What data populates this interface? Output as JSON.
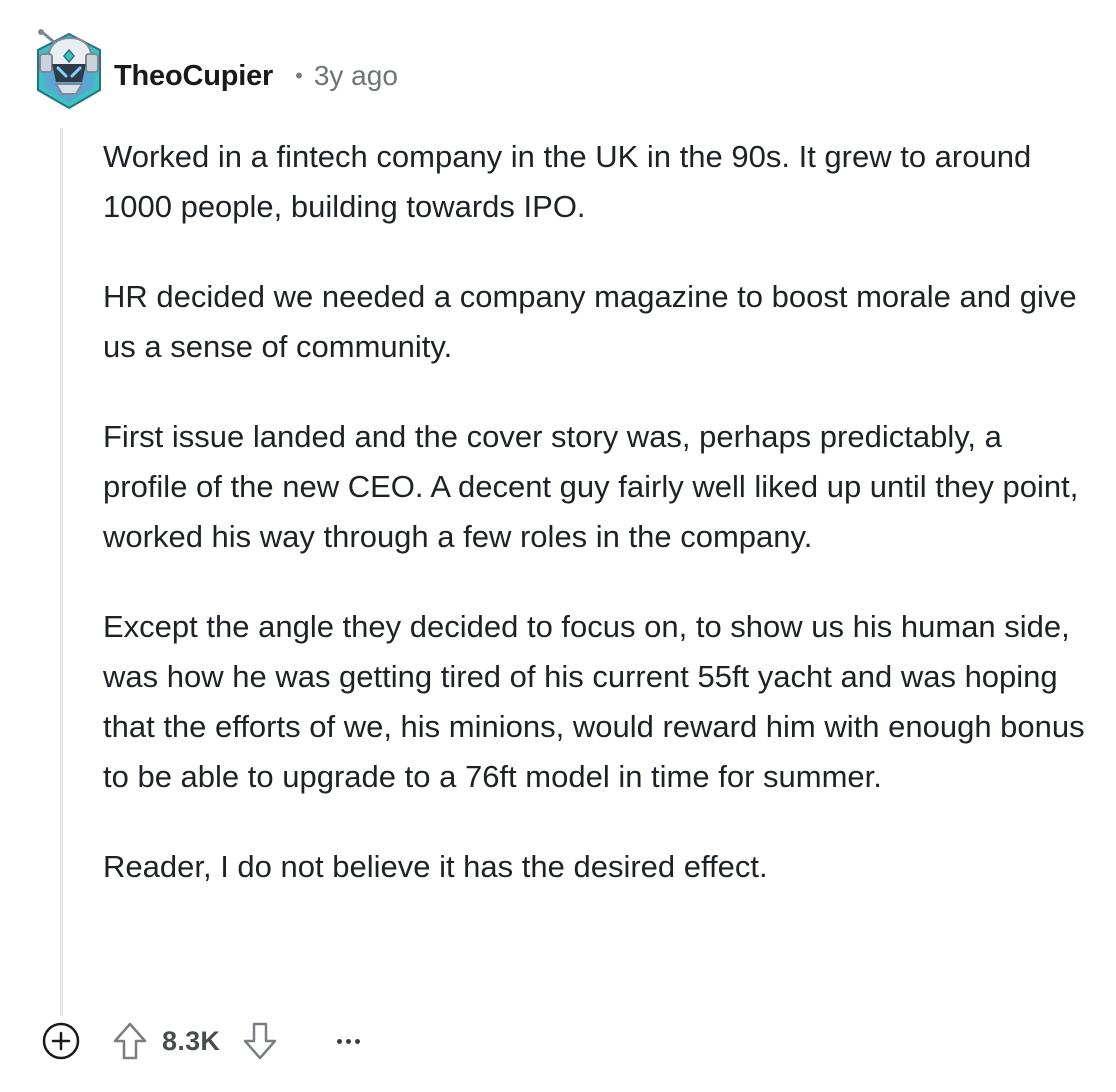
{
  "comment": {
    "author": "TheoCupier",
    "separator": "•",
    "time": "3y ago",
    "paragraphs": [
      "Worked in a fintech company in the UK in the 90s. It grew to around 1000 people, building towards IPO.",
      "HR decided we needed a company magazine to boost morale and give us a sense of community.",
      "First issue landed and the cover story was, perhaps predictably, a profile of the new CEO. A decent guy fairly well liked up until they point, worked his way through a few roles in the company.",
      "Except the angle they decided to focus on, to show us his human side, was how he was getting tired of his current 55ft yacht and was hoping that the efforts of we, his minions, would reward him with enough bonus to be able to upgrade to a 76ft model in time for summer.",
      "Reader, I do not believe it has the desired effect."
    ]
  },
  "actions": {
    "score": "8.3K",
    "expand_icon": "plus-circle-icon",
    "upvote_icon": "arrow-up-icon",
    "downvote_icon": "arrow-down-icon",
    "more_icon": "ellipsis-icon"
  },
  "colors": {
    "avatar_blue": "#5aa7d6",
    "avatar_teal": "#39c4c0",
    "thread_line": "#e3e6e8",
    "text": "#1e2226",
    "muted": "#6f7478"
  }
}
